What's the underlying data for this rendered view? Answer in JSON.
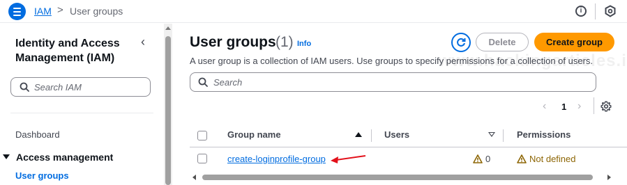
{
  "topbar": {
    "breadcrumb_root": "IAM",
    "breadcrumb_sep": ">",
    "breadcrumb_current": "User groups",
    "info_icon_glyph": "i"
  },
  "sidenav": {
    "title": "Identity and Access Management (IAM)",
    "collapse_glyph": "‹",
    "search_placeholder": "Search IAM",
    "dashboard_label": "Dashboard",
    "section_label": "Access management",
    "active_item_label": "User groups"
  },
  "page": {
    "title": "User groups",
    "count": "(1)",
    "info_label": "Info",
    "delete_label": "Delete",
    "create_label": "Create group",
    "description": "A user group is a collection of IAM users. Use groups to specify permissions for a collection of users.",
    "search_placeholder": "Search",
    "watermark": "www.hackingarticles.in"
  },
  "pagination": {
    "prev_glyph": "‹",
    "current_page": "1",
    "next_glyph": "›"
  },
  "table": {
    "columns": {
      "group_name": "Group name",
      "users": "Users",
      "permissions": "Permissions"
    },
    "rows": [
      {
        "group_name": "create-loginprofile-group",
        "users": "0",
        "permissions": "Not defined"
      }
    ]
  },
  "colors": {
    "accent": "#006ce0",
    "primary_button": "#ff9900",
    "warning": "#8d6605",
    "annotation_arrow": "#e3101a"
  }
}
